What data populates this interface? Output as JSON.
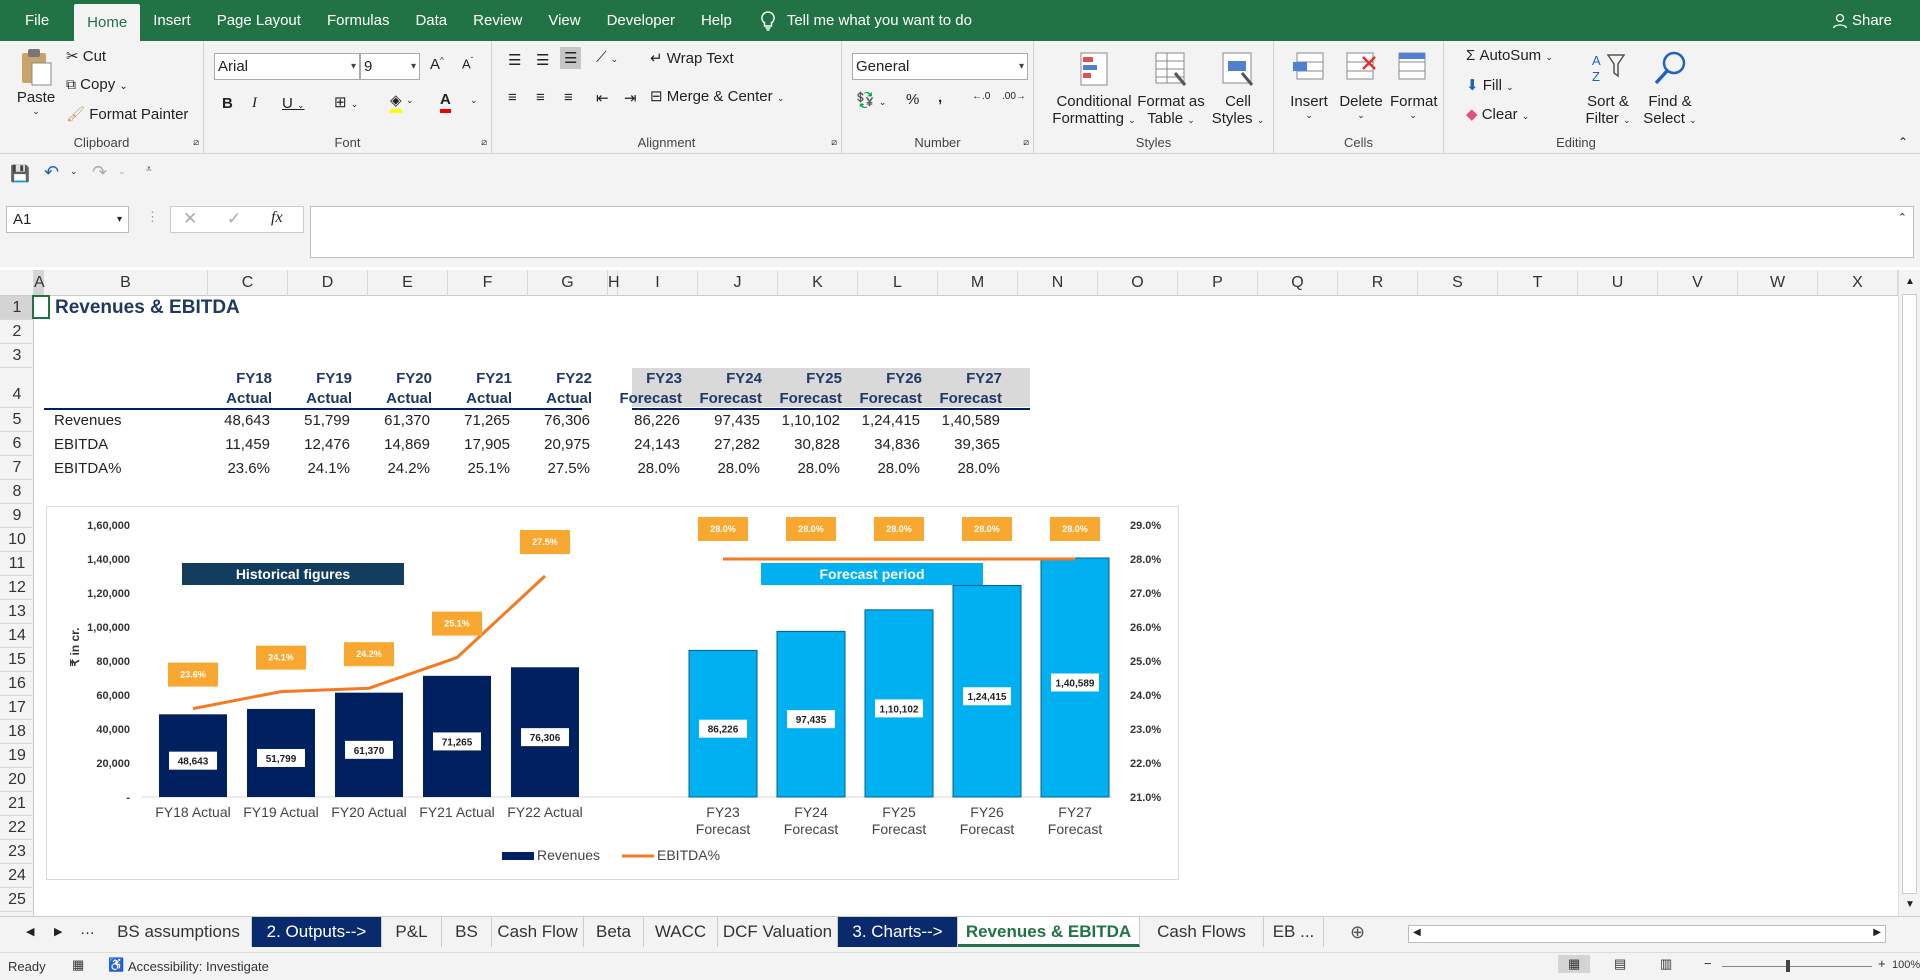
{
  "menu": {
    "tabs": [
      "File",
      "Home",
      "Insert",
      "Page Layout",
      "Formulas",
      "Data",
      "Review",
      "View",
      "Developer",
      "Help"
    ],
    "tell_me": "Tell me what you want to do",
    "share": "Share"
  },
  "ribbon": {
    "clipboard": {
      "label": "Clipboard",
      "paste": "Paste",
      "cut": "Cut",
      "copy": "Copy",
      "format_painter": "Format Painter"
    },
    "font": {
      "label": "Font",
      "name": "Arial",
      "size": "9"
    },
    "alignment": {
      "label": "Alignment",
      "wrap": "Wrap Text",
      "merge": "Merge & Center"
    },
    "number": {
      "label": "Number",
      "format": "General"
    },
    "styles": {
      "label": "Styles",
      "cond1": "Conditional",
      "cond2": "Formatting",
      "fmt1": "Format as",
      "fmt2": "Table",
      "cell1": "Cell",
      "cell2": "Styles"
    },
    "cells": {
      "label": "Cells",
      "insert": "Insert",
      "delete": "Delete",
      "format": "Format"
    },
    "editing": {
      "label": "Editing",
      "autosum": "AutoSum",
      "fill": "Fill",
      "clear": "Clear",
      "sort1": "Sort &",
      "sort2": "Filter",
      "find1": "Find &",
      "find2": "Select"
    }
  },
  "formula_bar": {
    "name_box": "A1",
    "fx": "fx"
  },
  "columns": [
    "A",
    "B",
    "C",
    "D",
    "E",
    "F",
    "G",
    "H",
    "I",
    "J",
    "K",
    "L",
    "M",
    "N",
    "O",
    "P",
    "Q",
    "R",
    "S",
    "T",
    "U",
    "V",
    "W",
    "X"
  ],
  "rows": [
    "1",
    "2",
    "3",
    "4",
    "5",
    "6",
    "7",
    "8",
    "9",
    "10",
    "11",
    "12",
    "13",
    "14",
    "15",
    "16",
    "17",
    "18",
    "19",
    "20",
    "21",
    "22",
    "23",
    "24",
    "25"
  ],
  "sheet": {
    "title": "Revenues & EBITDA",
    "periods": [
      {
        "fy": "FY18",
        "type": "Actual"
      },
      {
        "fy": "FY19",
        "type": "Actual"
      },
      {
        "fy": "FY20",
        "type": "Actual"
      },
      {
        "fy": "FY21",
        "type": "Actual"
      },
      {
        "fy": "FY22",
        "type": "Actual"
      },
      {
        "fy": "FY23",
        "type": "Forecast"
      },
      {
        "fy": "FY24",
        "type": "Forecast"
      },
      {
        "fy": "FY25",
        "type": "Forecast"
      },
      {
        "fy": "FY26",
        "type": "Forecast"
      },
      {
        "fy": "FY27",
        "type": "Forecast"
      }
    ],
    "table": [
      {
        "label": "Revenues",
        "values": [
          "48,643",
          "51,799",
          "61,370",
          "71,265",
          "76,306",
          "86,226",
          "97,435",
          "1,10,102",
          "1,24,415",
          "1,40,589"
        ]
      },
      {
        "label": "EBITDA",
        "values": [
          "11,459",
          "12,476",
          "14,869",
          "17,905",
          "20,975",
          "24,143",
          "27,282",
          "30,828",
          "34,836",
          "39,365"
        ]
      },
      {
        "label": "EBITDA%",
        "values": [
          "23.6%",
          "24.1%",
          "24.2%",
          "25.1%",
          "27.5%",
          "28.0%",
          "28.0%",
          "28.0%",
          "28.0%",
          "28.0%"
        ]
      }
    ]
  },
  "chart_data": {
    "type": "bar",
    "categories": [
      "FY18 Actual",
      "FY19 Actual",
      "FY20 Actual",
      "FY21 Actual",
      "FY22 Actual",
      "FY23 Forecast",
      "FY24 Forecast",
      "FY25 Forecast",
      "FY26 Forecast",
      "FY27 Forecast"
    ],
    "series": [
      {
        "name": "Revenues",
        "type": "bar",
        "values": [
          48643,
          51799,
          61370,
          71265,
          76306,
          86226,
          97435,
          110102,
          124415,
          140589
        ],
        "labels": [
          "48,643",
          "51,799",
          "61,370",
          "71,265",
          "76,306",
          "86,226",
          "97,435",
          "1,10,102",
          "1,24,415",
          "1,40,589"
        ]
      },
      {
        "name": "EBITDA%",
        "type": "line",
        "axis": "secondary",
        "values": [
          23.6,
          24.1,
          24.2,
          25.1,
          27.5,
          28.0,
          28.0,
          28.0,
          28.0,
          28.0
        ],
        "labels": [
          "23.6%",
          "24.1%",
          "24.2%",
          "25.1%",
          "27.5%",
          "28.0%",
          "28.0%",
          "28.0%",
          "28.0%",
          "28.0%"
        ]
      }
    ],
    "ylabel": "₹ in cr.",
    "ylim": [
      0,
      160000
    ],
    "y_ticks": [
      "-",
      "20,000",
      "40,000",
      "60,000",
      "80,000",
      "1,00,000",
      "1,20,000",
      "1,40,000",
      "1,60,000"
    ],
    "y2lim": [
      21,
      29
    ],
    "y2_ticks": [
      "21.0%",
      "22.0%",
      "23.0%",
      "24.0%",
      "25.0%",
      "26.0%",
      "27.0%",
      "28.0%",
      "29.0%"
    ],
    "annotations": [
      "Historical figures",
      "Forecast period"
    ],
    "legend": "bottom",
    "colors": {
      "actual": "#002060",
      "forecast": "#00b0f0",
      "line": "#f47920",
      "label_box": "#f8a830"
    }
  },
  "sheet_tabs": [
    "BS assumptions",
    "2. Outputs-->",
    "P&L",
    "BS",
    "Cash Flow",
    "Beta",
    "WACC",
    "DCF Valuation",
    "3. Charts-->",
    "Revenues & EBITDA",
    "Cash Flows",
    "EB ..."
  ],
  "status": {
    "ready": "Ready",
    "accessibility": "Accessibility: Investigate",
    "zoom": "100%"
  }
}
